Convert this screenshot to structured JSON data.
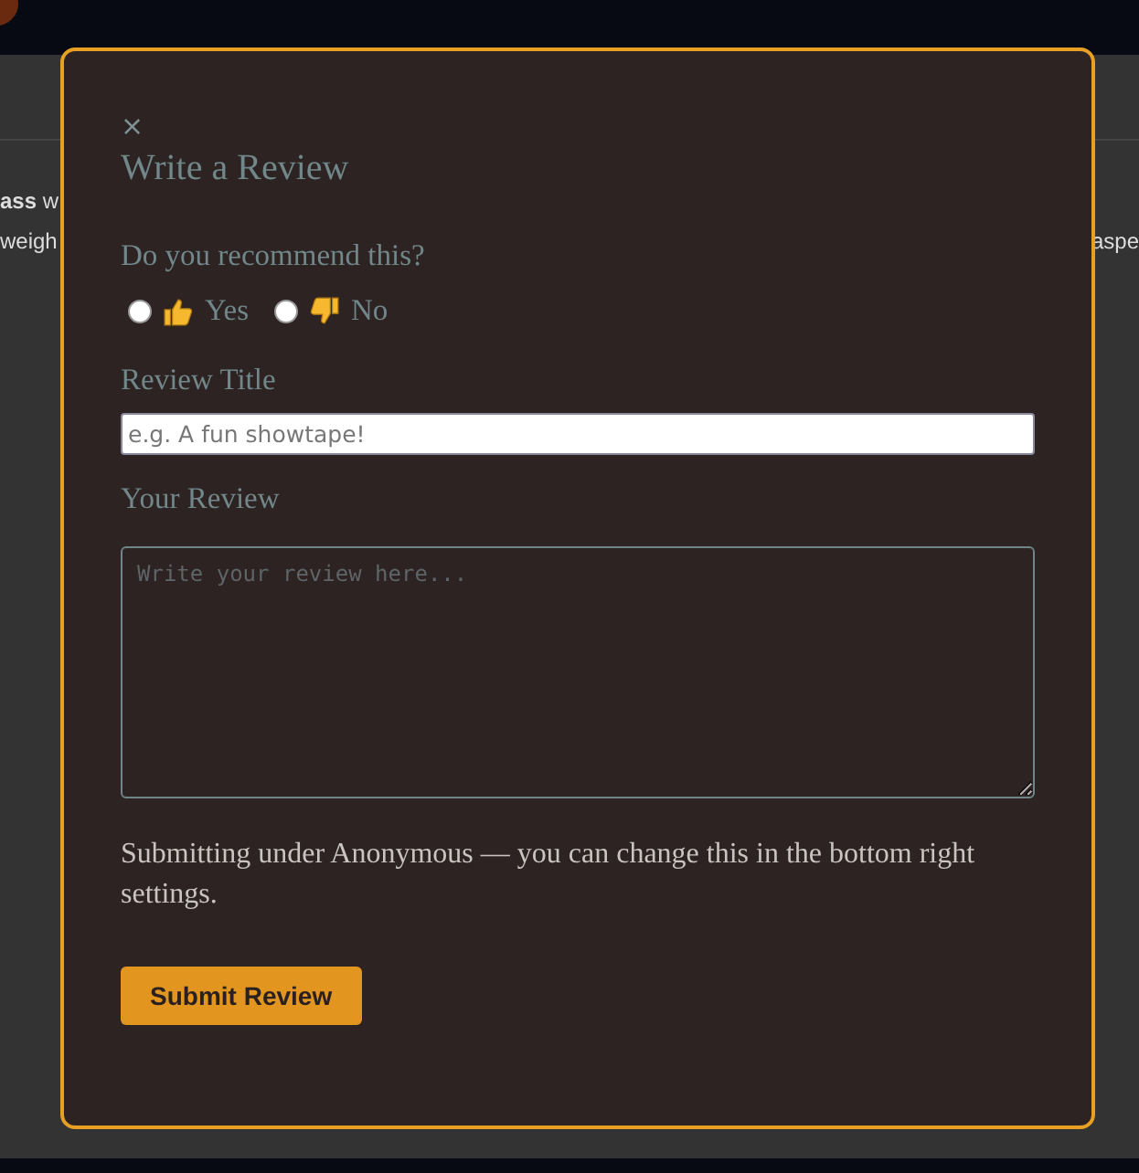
{
  "background": {
    "left_lines": [
      "**ass** w",
      "weigh"
    ],
    "right_lines": [
      "aspe"
    ]
  },
  "dialog": {
    "close": "×",
    "title": "Write a Review",
    "recommend": {
      "label": "Do you recommend this?",
      "options": [
        {
          "kind": "up",
          "label": "Yes",
          "selected": false
        },
        {
          "kind": "down",
          "label": "No",
          "selected": false
        }
      ]
    },
    "title_field": {
      "label": "Review Title",
      "placeholder": "e.g. A fun showtape!"
    },
    "review_field": {
      "label": "Your Review",
      "placeholder": "Write your review here..."
    },
    "note": "Submitting under Anonymous — you can change this in the bottom right settings.",
    "submit": "Submit Review"
  }
}
